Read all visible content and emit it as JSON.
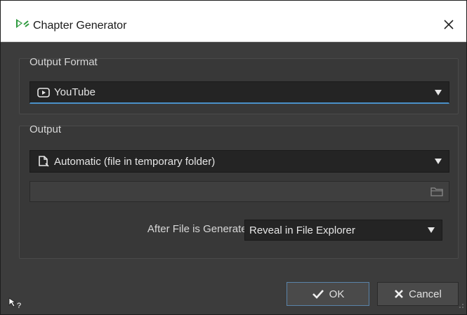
{
  "window": {
    "title": "Chapter Generator",
    "icon": "chapter-generator-app-icon",
    "close_icon": "close-icon"
  },
  "output_format": {
    "group_title": "Output Format",
    "selected": "YouTube",
    "icon": "youtube-play-icon"
  },
  "output": {
    "group_title": "Output",
    "selected": "Automatic (file in temporary folder)",
    "icon": "new-file-icon",
    "path_value": "",
    "folder_icon": "folder-icon",
    "after_label": "After File is Generated",
    "after_selected": "Reveal in File Explorer"
  },
  "buttons": {
    "ok_label": "OK",
    "cancel_label": "Cancel"
  },
  "colors": {
    "accent": "#4a90c8",
    "dialog_bg": "#3c3c3c",
    "field_bg": "#242424"
  }
}
